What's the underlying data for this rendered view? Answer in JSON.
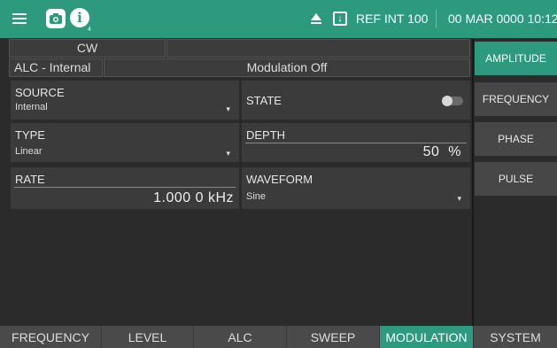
{
  "topbar": {
    "ref_text": "REF INT 100",
    "date_text": "00 MAR 0000 10:12",
    "info_sub": "4",
    "icons": [
      "menu-icon",
      "camera-icon",
      "info-icon",
      "eject-icon",
      "import-icon"
    ]
  },
  "header": {
    "mode": "CW",
    "alc": "ALC - Internal",
    "modulation_status": "Modulation Off"
  },
  "panels": {
    "source": {
      "label": "SOURCE",
      "value": "Internal"
    },
    "state": {
      "label": "STATE",
      "toggle_on": false
    },
    "type": {
      "label": "TYPE",
      "value": "Linear"
    },
    "depth": {
      "label": "DEPTH",
      "value": "50",
      "unit": "%"
    },
    "rate": {
      "label": "RATE",
      "value": "1.000 0",
      "unit": "kHz"
    },
    "waveform": {
      "label": "WAVEFORM",
      "value": "Sine"
    }
  },
  "side_tabs": [
    "AMPLITUDE",
    "FREQUENCY",
    "PHASE",
    "PULSE"
  ],
  "side_active": "AMPLITUDE",
  "bottom_tabs": [
    "FREQUENCY",
    "LEVEL",
    "ALC",
    "SWEEP",
    "MODULATION",
    "SYSTEM"
  ],
  "bottom_active": "MODULATION",
  "colors": {
    "accent": "#2d9a7e",
    "background": "#2b2b2b",
    "panel": "#3b3b3b"
  }
}
